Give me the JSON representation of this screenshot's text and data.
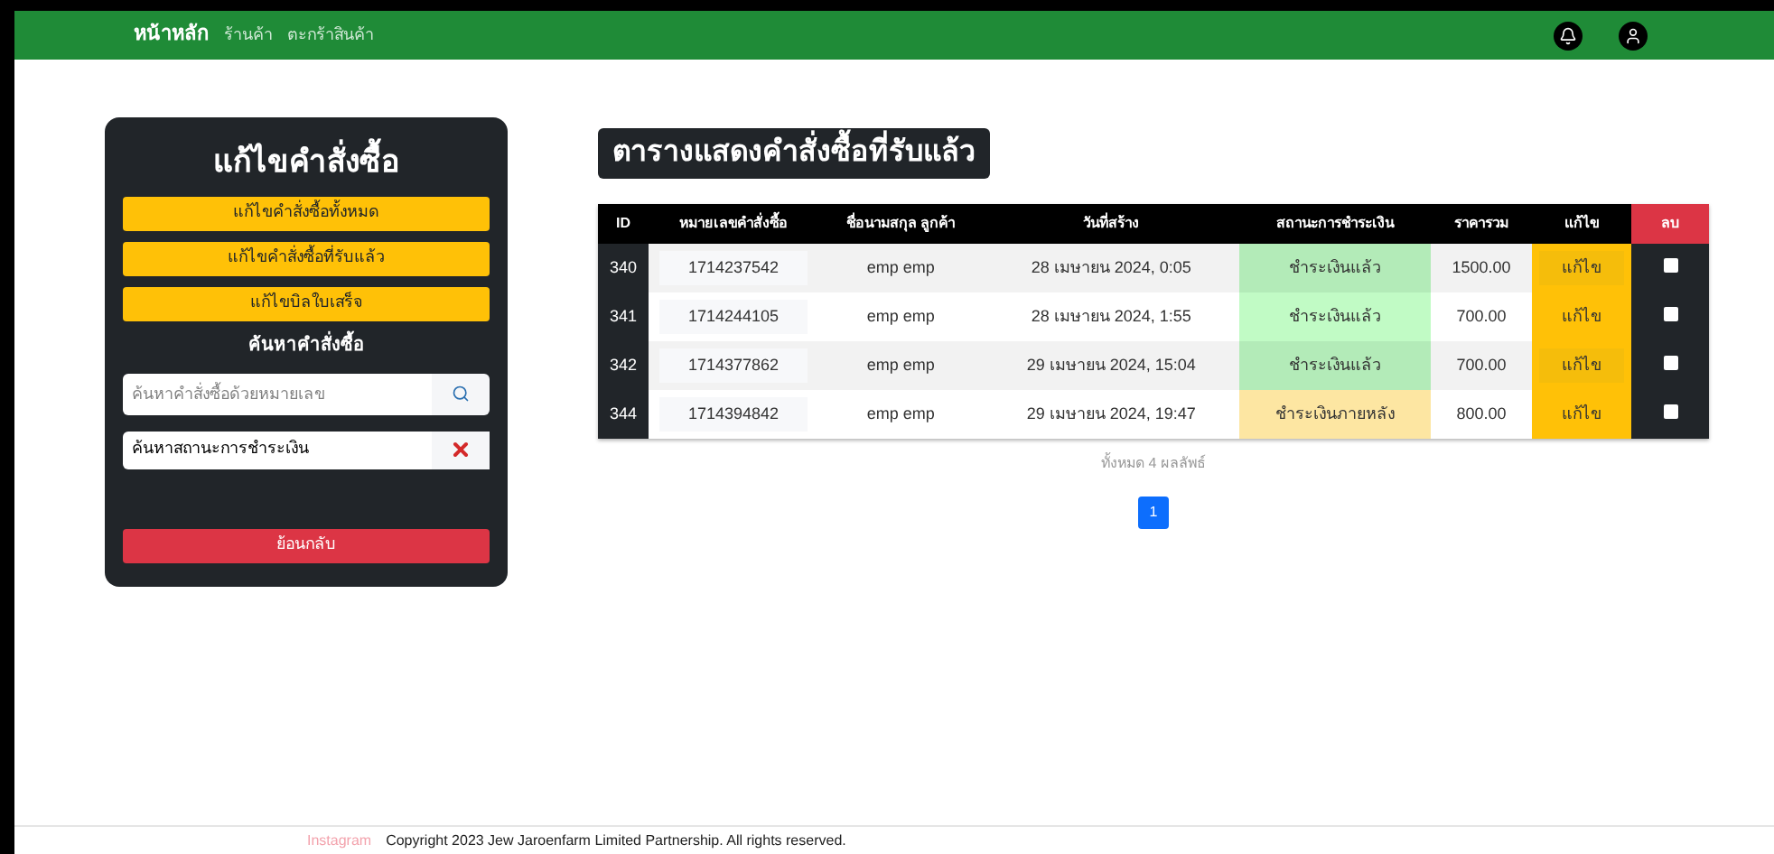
{
  "navbar": {
    "brand": "หน้าหลัก",
    "links": [
      "ร้านค้า",
      "ตะกร้าสินค้า"
    ]
  },
  "sidebar": {
    "title": "แก้ไขคำสั่งซื้อ",
    "buttons": [
      "แก้ไขคำสั่งซื้อทั้งหมด",
      "แก้ไขคำสั่งซื้อที่รับแล้ว",
      "แก้ไขบิลใบเสร็จ"
    ],
    "search_title": "ค้นหาคำสั่งซื้อ",
    "search": {
      "placeholder": "ค้นหาคำสั่งซื้อด้วยหมายเลข"
    },
    "status_select": {
      "value": "ค้นหาสถานะการชำระเงิน"
    },
    "back_button": "ย้อนกลับ"
  },
  "table": {
    "title": "ตารางแสดงคำสั่งซื้อที่รับแล้ว",
    "columns": [
      "ID",
      "หมายเลขคำสั่งซื้อ",
      "ชื่อนามสกุล ลูกค้า",
      "วันที่สร้าง",
      "สถานะการชำระเงิน",
      "ราคารวม",
      "แก้ไข",
      "ลบ"
    ],
    "rows": [
      {
        "id": "340",
        "order_no": "1714237542",
        "customer": "emp emp",
        "created": "28 เมษายน 2024, 0:05",
        "status": "ชำระเงินแล้ว",
        "kind": "paid",
        "total": "1500.00",
        "edit": "แก้ไข",
        "checked": false
      },
      {
        "id": "341",
        "order_no": "1714244105",
        "customer": "emp emp",
        "created": "28 เมษายน 2024, 1:55",
        "status": "ชำระเงินแล้ว",
        "kind": "paid",
        "total": "700.00",
        "edit": "แก้ไข",
        "checked": false
      },
      {
        "id": "342",
        "order_no": "1714377862",
        "customer": "emp emp",
        "created": "29 เมษายน 2024, 15:04",
        "status": "ชำระเงินแล้ว",
        "kind": "paid",
        "total": "700.00",
        "edit": "แก้ไข",
        "checked": false
      },
      {
        "id": "344",
        "order_no": "1714394842",
        "customer": "emp emp",
        "created": "29 เมษายน 2024, 19:47",
        "status": "ชำระเงินภายหลัง",
        "kind": "later",
        "total": "800.00",
        "edit": "แก้ไข",
        "checked": false
      }
    ],
    "summary": "ทั้งหมด 4 ผลลัพธ์",
    "pages": [
      {
        "label": "1",
        "selected": true
      }
    ]
  },
  "footer": {
    "links": [
      "Instagram"
    ],
    "copyright": "Copyright 2023 Jew Jaroenfarm Limited Partnership. All rights reserved."
  }
}
